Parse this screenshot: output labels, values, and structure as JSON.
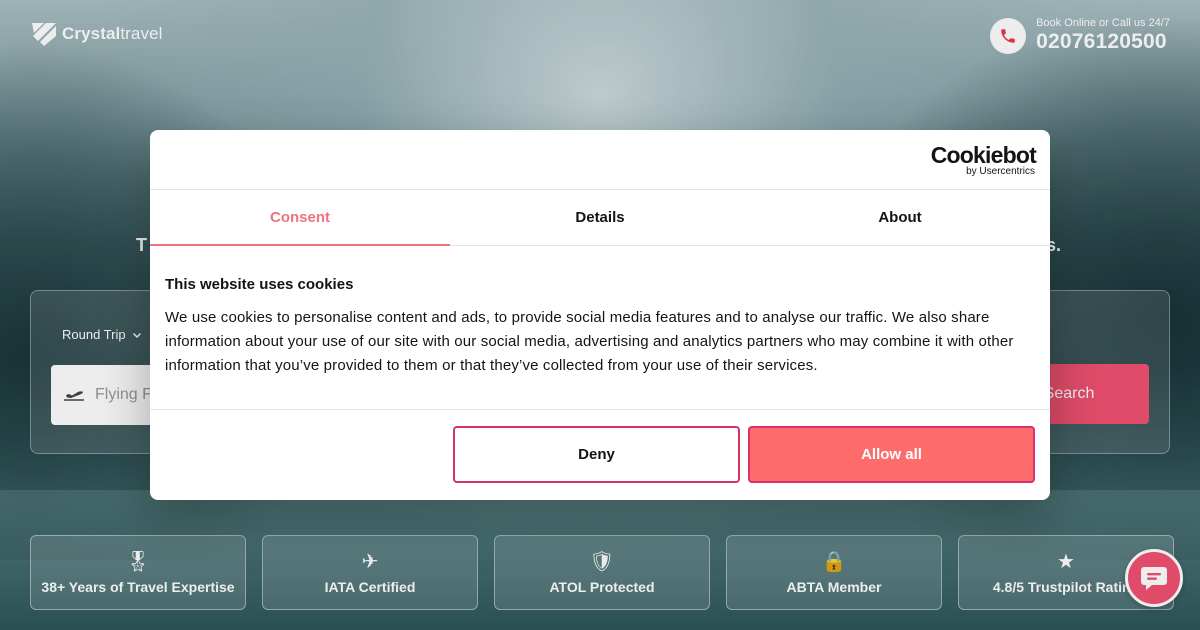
{
  "header": {
    "logo_bold": "Crystal",
    "logo_light": "travel",
    "contact_small": "Book Online or Call us 24/7",
    "contact_number": "02076120500"
  },
  "hero": {
    "fragment_left": "T",
    "fragment_right": "s."
  },
  "search": {
    "trip_type": "Round Trip",
    "from_placeholder": "Flying From",
    "search_label": "Search"
  },
  "features": [
    {
      "icon": "medal-icon",
      "glyph": "🎖",
      "label": "38+ Years of Travel Expertise"
    },
    {
      "icon": "airplane-icon",
      "glyph": "✈",
      "label": "IATA Certified"
    },
    {
      "icon": "shield-check-icon",
      "glyph": "🛡",
      "label": "ATOL Protected"
    },
    {
      "icon": "lock-icon",
      "glyph": "🔒",
      "label": "ABTA Member"
    },
    {
      "icon": "star-icon",
      "glyph": "★",
      "label": "4.8/5 Trustpilot Rating"
    }
  ],
  "cookie_dialog": {
    "brand": "Cookiebot",
    "brand_sub": "by Usercentrics",
    "tabs": [
      {
        "label": "Consent",
        "active": true
      },
      {
        "label": "Details",
        "active": false
      },
      {
        "label": "About",
        "active": false
      }
    ],
    "title": "This website uses cookies",
    "text": "We use cookies to personalise content and ads, to provide social media features and to analyse our traffic. We also share information about your use of our site with our social media, advertising and analytics partners who may combine it with other information that you’ve provided to them or that they’ve collected from your use of their services.",
    "deny_label": "Deny",
    "allow_label": "Allow all"
  },
  "colors": {
    "accent": "#f0506e",
    "tab_active": "#f0727d",
    "allow_bg": "#fe6b6b",
    "button_border": "#d6336c"
  }
}
